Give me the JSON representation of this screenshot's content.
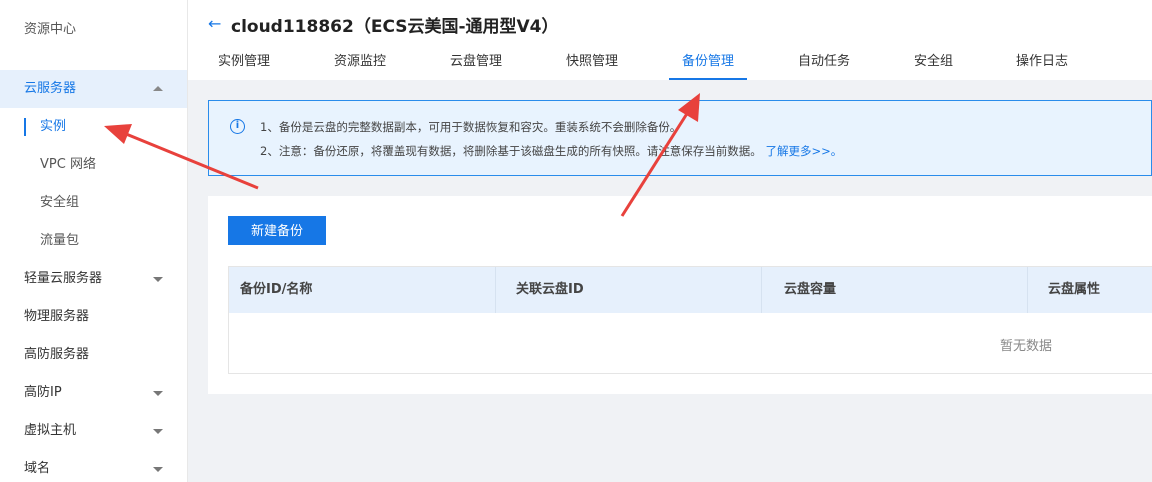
{
  "sidebar": {
    "header": "资源中心",
    "items": [
      {
        "label": "云服务器",
        "expanded": true
      },
      {
        "label": "实例"
      },
      {
        "label": "VPC 网络"
      },
      {
        "label": "安全组"
      },
      {
        "label": "流量包"
      },
      {
        "label": "轻量云服务器"
      },
      {
        "label": "物理服务器"
      },
      {
        "label": "高防服务器"
      },
      {
        "label": "高防IP"
      },
      {
        "label": "虚拟主机"
      },
      {
        "label": "域名"
      }
    ]
  },
  "header": {
    "back_icon": "arrow-left-icon",
    "title": "cloud118862（ECS云美国-通用型V4）"
  },
  "tabs": [
    {
      "label": "实例管理"
    },
    {
      "label": "资源监控"
    },
    {
      "label": "云盘管理"
    },
    {
      "label": "快照管理"
    },
    {
      "label": "备份管理",
      "active": true
    },
    {
      "label": "自动任务"
    },
    {
      "label": "安全组"
    },
    {
      "label": "操作日志"
    }
  ],
  "notice": {
    "line1": "1、备份是云盘的完整数据副本，可用于数据恢复和容灾。重装系统不会删除备份。",
    "line2": "2、注意：备份还原，将覆盖现有数据，将删除基于该磁盘生成的所有快照。请注意保存当前数据。",
    "link": "了解更多>>。"
  },
  "main": {
    "new_button": "新建备份",
    "table": {
      "columns": [
        "备份ID/名称",
        "关联云盘ID",
        "云盘容量",
        "云盘属性"
      ],
      "empty_text": "暂无数据"
    }
  },
  "colors": {
    "accent": "#1677e6",
    "annotation_arrow": "#e8413c"
  }
}
